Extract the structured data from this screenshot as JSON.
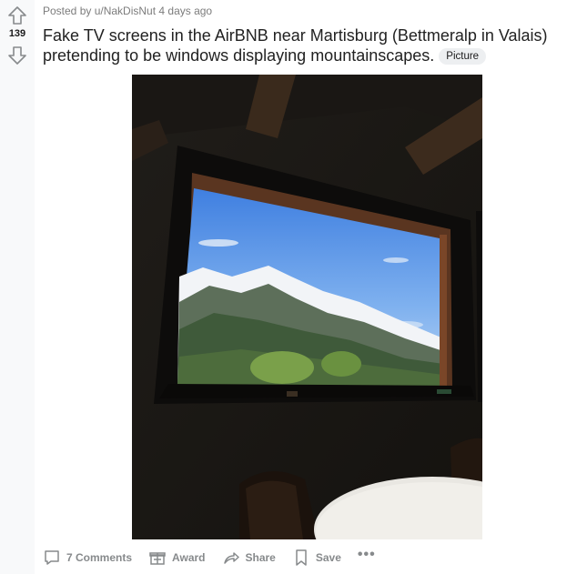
{
  "post": {
    "meta": "Posted by u/NakDisNut 4 days ago",
    "score": "139",
    "title": "Fake TV screens in the AirBNB near Martisburg (Bettmeralp in Valais) pretending to be windows displaying mountainscapes.",
    "flair": "Picture"
  },
  "actions": {
    "comments": "7 Comments",
    "award": "Award",
    "share": "Share",
    "save": "Save",
    "more": "•••"
  },
  "icons": {
    "upvote": "upvote-arrow-icon",
    "downvote": "downvote-arrow-icon",
    "comments": "comment-bubble-icon",
    "award": "gift-icon",
    "share": "share-arrow-icon",
    "save": "bookmark-icon",
    "more": "more-dots-icon"
  },
  "colors": {
    "rail": "#f8f9fa",
    "action_text": "#878a8c",
    "flair_bg": "#edeff1"
  }
}
